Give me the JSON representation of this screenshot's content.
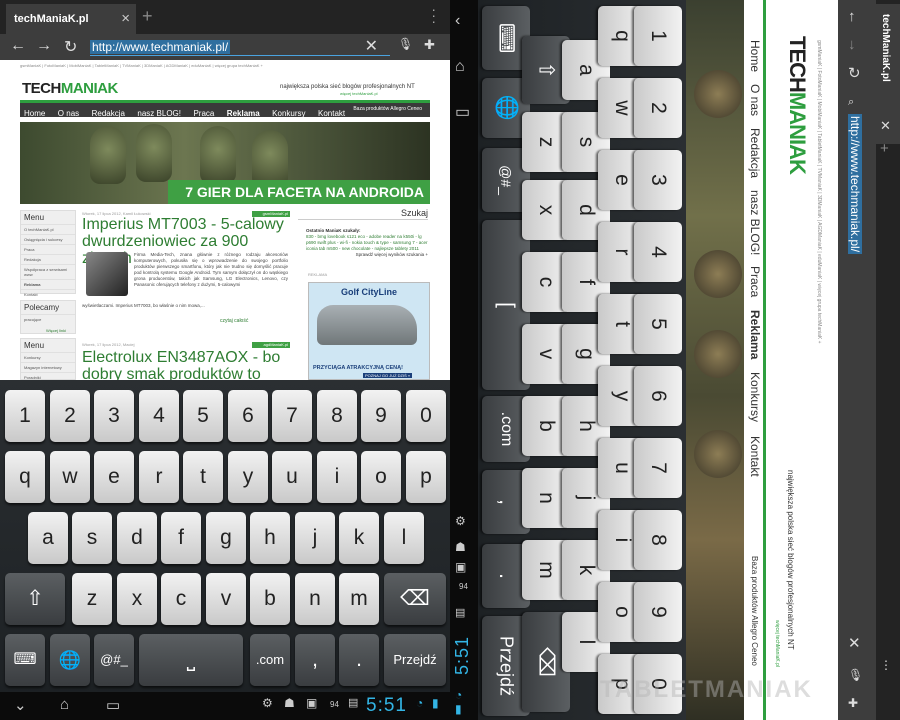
{
  "left": {
    "tab_title": "techManiaK.pl",
    "tab_close": "×",
    "new_tab": "+",
    "url": "http://www.techmaniak.pl/",
    "site": {
      "top_links": "gsmManiaK  |  FotoManiaK  |  MobiManiaK  |  TabletManiaK  |  TVManiaK  |  3DManiaK  |  AGDManiaK  |  eduManiaK  |  więcej grupa techManiaK +",
      "logo_a": "TECH",
      "logo_b": "MANIAK",
      "tagline": "największa polska sieć blogów profesjonalnych NT",
      "tagline_link": "więcej techManiaK.pl",
      "menu": [
        "Home",
        "O nas",
        "Redakcja",
        "nasz BLOG!",
        "Praca",
        "Reklama",
        "Konkursy",
        "Kontakt"
      ],
      "menu_right": "Baza produktów   Allegro   Ceneo",
      "banner_caption": "7 GIER DLA FACETA NA ANDROIDA",
      "sidebar_menu_title": "Menu",
      "sidebar_menu_items": [
        "O techManiaK.pl",
        "Osiągnięcia i sukcesy",
        "Praca",
        "Redakcja",
        "Współpraca z serwisami www",
        "Reklama",
        "Kontakt"
      ],
      "sidebar_polecamy": "Polecamy",
      "sidebar_polecamy_item": "pracujące",
      "sidebar_polecamy_more": "Więcej linki",
      "sidebar_menu2_title": "Menu",
      "sidebar_menu2_items": [
        "Konkursy",
        "Magazyn internetowy",
        "Poradniki"
      ],
      "article1_date": "Wtorek, 17 lipca 2012, Kamil Łukowski",
      "article1_badge": "gsmManiaK.pl",
      "article1_title": "Imperius MT7003 - 5-calowy dwurdzeniowiec za 900 złotych",
      "article1_body": "Firma Media-Tech, znana głównie z różnego rodzaju akcesoriów komputerowych, pokusiła się o wprowadzenie do swojego portfolio produktów pierwszego smartfonu, który jak nie trudno się domyślić pracuje pod kontrolą systemu Google Android. Tym samym dołączył on do wąskiego grona producentów, takich jak Samsung, LG Electronics, Lenovo, czy Panasonic oferujących telefony z dużymi, 5-calowymi",
      "article1_body2": "wyświetlaczami. Imperius MT7003, bo właśnie o nim mowa,...",
      "article1_more": "czytaj całość",
      "article2_date": "Wtorek, 17 lipca 2012, Maciej",
      "article2_badge": "agdManiaK.pl",
      "article2_title": "Electrolux EN3487AOX - bo dobry smak produktów to",
      "search_label": "Szukaj",
      "last_title": "Ostatnio ManiaK szukały:",
      "last_links": "830 - bmg lovebook s121 eco - adobe reader na k550i - lg p690 swift plus - wi-fi - nokia touch & type - samsung 7 - acer iconia tab m500 - new chocolate - najlepsze tablety 2011",
      "last_more": "Sprawdź więcej wyników szukania +",
      "ad_label": "REKLAMA",
      "ad_brand": "Golf CityLine",
      "ad_cta": "PRZYCIĄGA ATRAKCYJNĄ CENĄ!",
      "ad_cta2": "POZNAJ GO JUŻ DZIŚ »"
    },
    "keyboard": {
      "row1": [
        "1",
        "2",
        "3",
        "4",
        "5",
        "6",
        "7",
        "8",
        "9",
        "0"
      ],
      "row2": [
        "q",
        "w",
        "e",
        "r",
        "t",
        "y",
        "u",
        "i",
        "o",
        "p"
      ],
      "row3": [
        "a",
        "s",
        "d",
        "f",
        "g",
        "h",
        "j",
        "k",
        "l"
      ],
      "row4": [
        "z",
        "x",
        "c",
        "v",
        "b",
        "n",
        "m"
      ],
      "symbols": "@#_",
      "space": "⎵",
      "dotcom": ".com",
      "comma": ",",
      "period": ".",
      "enter": "Przejdź"
    },
    "status": {
      "time": "5:51",
      "battery": "94"
    }
  },
  "mid": {
    "keyboard": {
      "num": [
        "1",
        "2",
        "3",
        "4",
        "5",
        "6",
        "7",
        "8",
        "9",
        "0"
      ],
      "qrow": [
        "q",
        "w",
        "e",
        "r",
        "t",
        "y",
        "u",
        "i",
        "o",
        "p"
      ],
      "arow": [
        "a",
        "s",
        "d",
        "f",
        "g",
        "h",
        "j",
        "k",
        "l"
      ],
      "zrow": [
        "z",
        "x",
        "c",
        "v",
        "b",
        "n",
        "m"
      ],
      "symbols": "@#_",
      "space": "[",
      "dotcom": ".com",
      "comma": ",",
      "period": ".",
      "enter": "Przejdź"
    },
    "status": {
      "time": "5:51",
      "battery": "94"
    }
  },
  "right": {
    "title": "techManiaK.pl",
    "url": "http://www.techmaniak.pl/",
    "logo_a": "TECH",
    "logo_b": "MANIAK",
    "top_links": "gsmManiaK  |  FotoManiaK  |  MobiManiaK  |  TabletManiaK  |  TVManiaK  |  3DManiaK  |  AGDManiaK  |  eduManiaK  |  więcej grupa techManiaK +",
    "tagline": "największa polska sieć blogów profesjonalnych NT",
    "tagline_link": "więcej techManiaK.pl",
    "menu": [
      "Home",
      "O nas",
      "Redakcja",
      "nasz BLOG!",
      "Praca",
      "Reklama",
      "Konkursy",
      "Kontakt"
    ],
    "menu_right": "Baza produktów   Allegro   Ceneo",
    "watermark": "TABLETMANIAK"
  },
  "colors": {
    "accent": "#2e9e3f",
    "clock": "#33b5e5",
    "url_highlight": "#2f6f9f"
  },
  "icons": [
    "back-icon",
    "forward-icon",
    "refresh-icon",
    "search-icon",
    "clear-icon",
    "mic-icon",
    "bookmark-icon",
    "menu-overflow-icon",
    "keyboard-icon",
    "globe-icon",
    "shift-icon",
    "backspace-icon",
    "nav-back-icon",
    "nav-home-icon",
    "nav-recent-icon",
    "wifi-icon"
  ]
}
